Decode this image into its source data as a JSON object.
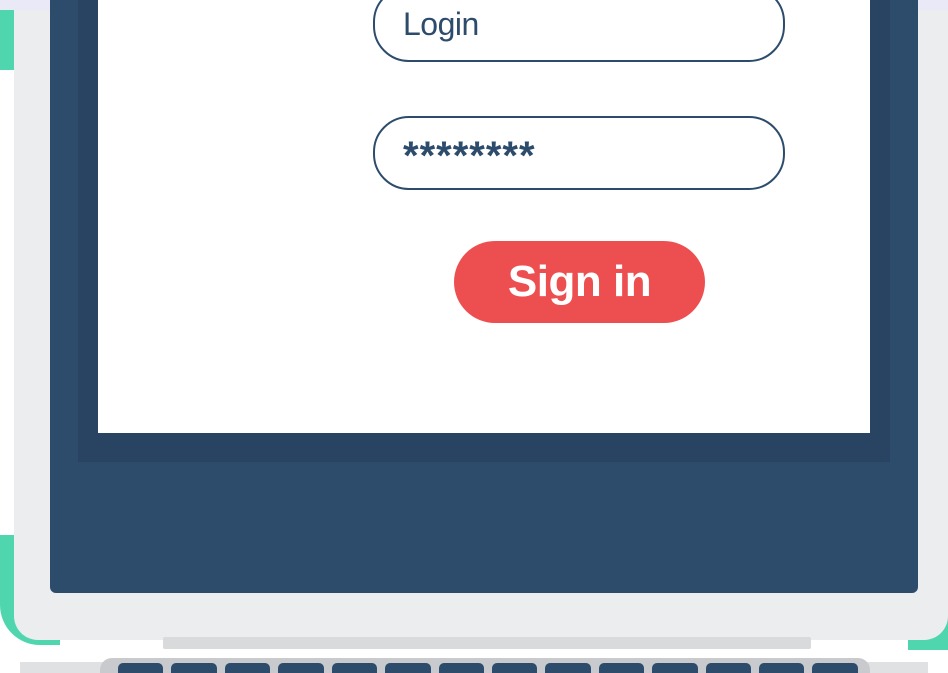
{
  "login_form": {
    "login_value": "Login",
    "password_value": "********",
    "signin_label": "Sign in"
  },
  "colors": {
    "bezel": "#2d4c6c",
    "button": "#ed4f50",
    "accent": "#4fd6ae",
    "screen": "#ffffff"
  },
  "keyboard": {
    "keys_visible": 14
  }
}
